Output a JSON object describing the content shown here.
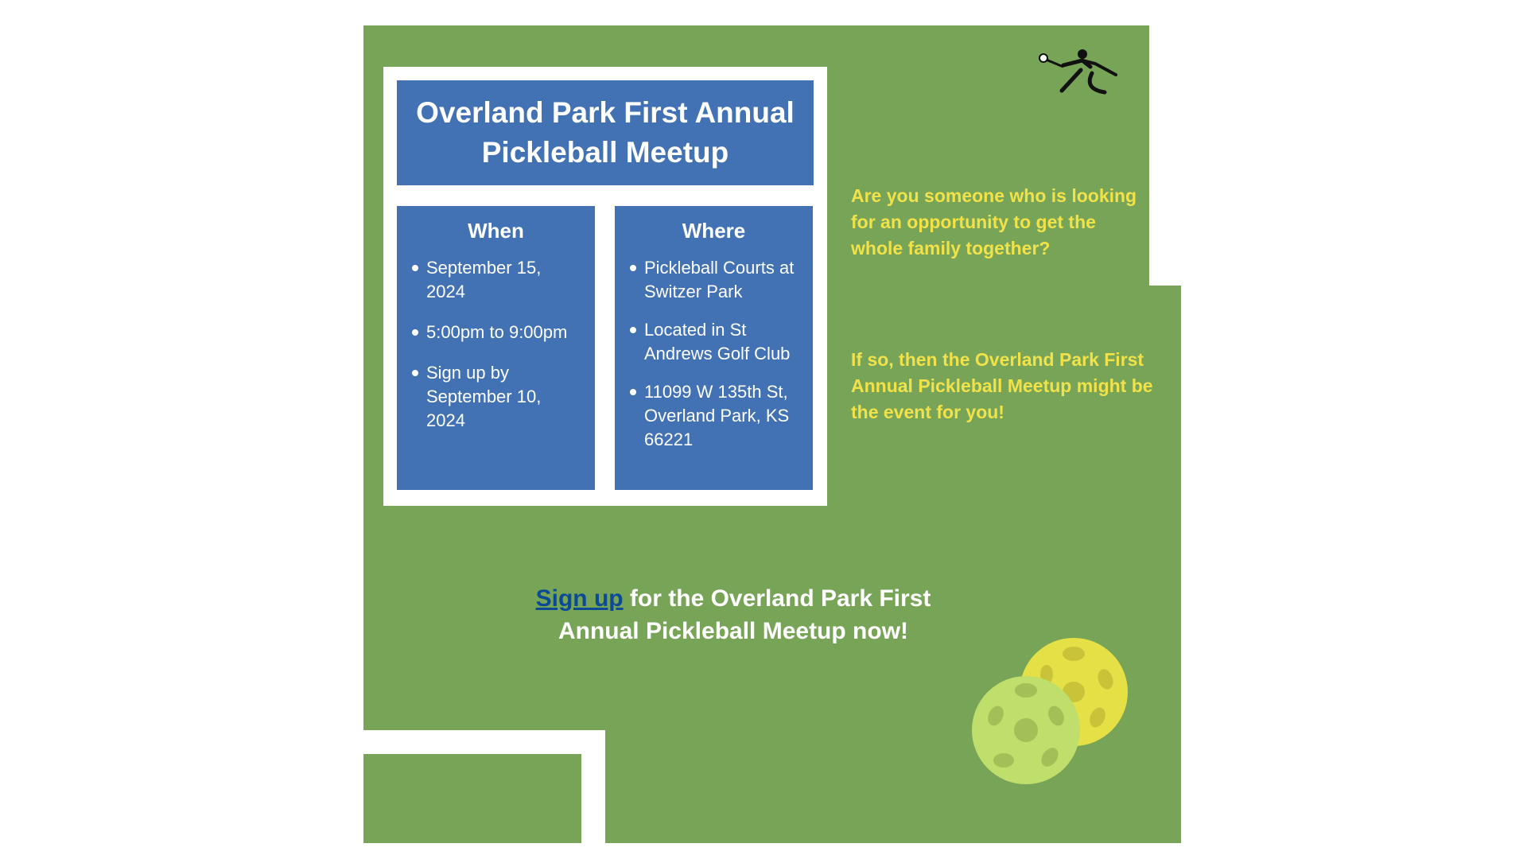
{
  "title": "Overland Park First Annual Pickleball Meetup",
  "when": {
    "heading": "When",
    "items": [
      "September 15, 2024",
      "5:00pm to 9:00pm",
      "Sign up by September 10, 2024"
    ]
  },
  "where": {
    "heading": "Where",
    "items": [
      "Pickleball Courts at Switzer Park",
      "Located in St Andrews Golf Club",
      "11099 W 135th St, Overland Park, KS 66221"
    ]
  },
  "promo": {
    "question": "Are you someone who is looking for an opportunity to get the whole family together?",
    "answer": "If so, then the Overland Park First Annual Pickleball Meetup might be the event for you!"
  },
  "signup": {
    "link_text": "Sign up",
    "rest_text": " for the Overland Park First Annual Pickleball Meetup now!"
  },
  "icons": {
    "player": "pickleball-player-icon",
    "balls": "pickleball-balls-icon"
  },
  "colors": {
    "background_green": "#78a457",
    "panel_blue": "#4272b4",
    "promo_yellow": "#f2e24a",
    "link_blue": "#0b4a94"
  }
}
